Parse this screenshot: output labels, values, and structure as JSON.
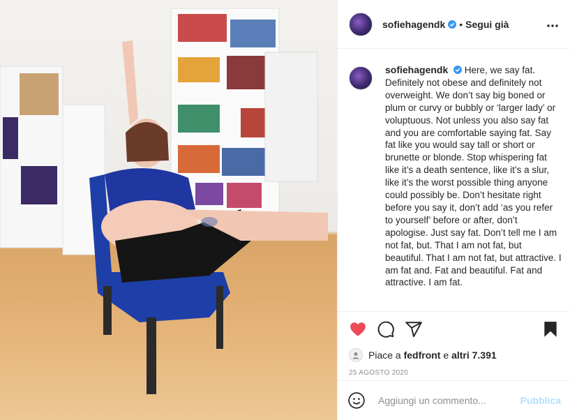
{
  "header": {
    "username": "sofiehagendk",
    "separator": "•",
    "follow_status": "Segui già"
  },
  "caption": {
    "username": "sofiehagendk",
    "text": "Here, we say fat. Definitely not obese and definitely not overweight. We don’t say big boned or plum or curvy or bubbly or ‘larger lady’ or voluptuous. Not unless you also say fat and you are comfortable saying fat. Say fat like you would say tall or short or brunette or blonde. Stop whispering fat like it’s a death sentence, like it’s a slur, like it’s the worst possible thing anyone could possibly be. Don’t hesitate right before you say it, don’t add ‘as you refer to yourself’ before or after, don’t apologise. Just say fat. Don’t tell me I am not fat, but. That I am not fat, but beautiful. That I am not fat, but attractive. I am fat and. Fat and beautiful. Fat and attractive. I am fat."
  },
  "likes": {
    "prefix": "Piace a",
    "user": "fedfront",
    "joiner": "e",
    "others": "altri 7.391"
  },
  "date": "25 AGOSTO 2020",
  "comment": {
    "placeholder": "Aggiungi un commento...",
    "publish_label": "Pubblica"
  },
  "colors": {
    "like_red": "#ed4956",
    "verified_blue": "#3897f0",
    "publish_disabled": "#b2dffc"
  },
  "icons": [
    "more-options-icon",
    "verified-icon",
    "heart-icon",
    "comment-icon",
    "share-icon",
    "bookmark-icon",
    "emoji-icon"
  ]
}
